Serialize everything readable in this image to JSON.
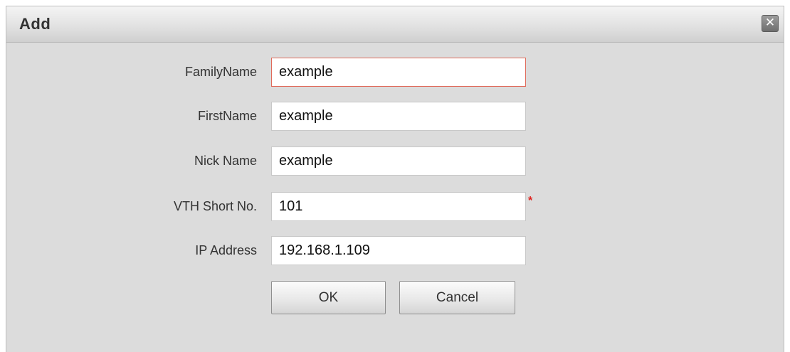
{
  "dialog": {
    "title": "Add",
    "close_icon": "close-icon"
  },
  "form": {
    "fields": [
      {
        "label": "FamilyName",
        "value": "example"
      },
      {
        "label": "FirstName",
        "value": "example"
      },
      {
        "label": "Nick Name",
        "value": "example"
      },
      {
        "label": "VTH Short No.",
        "value": "101",
        "required_mark": "*"
      },
      {
        "label": "IP Address",
        "value": "192.168.1.109"
      }
    ]
  },
  "buttons": {
    "ok_label": "OK",
    "cancel_label": "Cancel"
  },
  "colors": {
    "dialog_background": "#dcdcdc",
    "focused_border": "#e06a5a",
    "required_mark": "#e0201c"
  }
}
